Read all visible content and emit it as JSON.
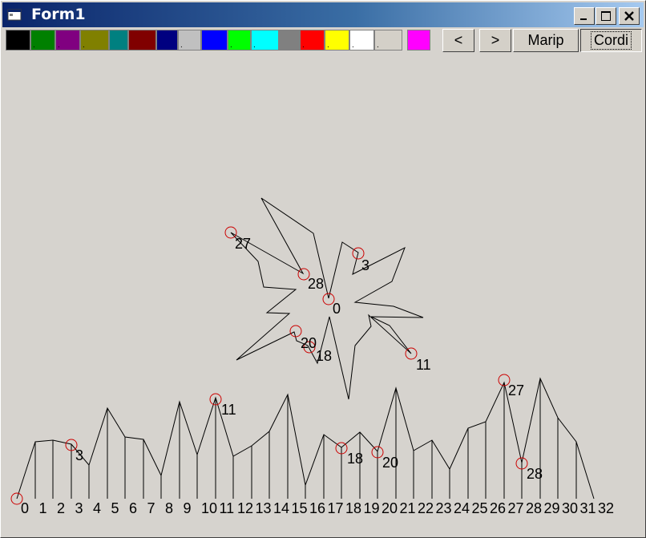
{
  "window": {
    "title": "Form1"
  },
  "palette": [
    {
      "color": "#000000",
      "mark": ""
    },
    {
      "color": "#008000",
      "mark": "."
    },
    {
      "color": "#800080",
      "mark": "."
    },
    {
      "color": "#808000",
      "mark": "."
    },
    {
      "color": "#008080",
      "mark": ""
    },
    {
      "color": "#800000",
      "mark": ""
    },
    {
      "color": "#000080",
      "mark": ""
    },
    {
      "color": "#c0c0c0",
      "mark": "."
    },
    {
      "color": "#0000ff",
      "mark": ""
    },
    {
      "color": "#00ff00",
      "mark": "."
    },
    {
      "color": "#00ffff",
      "mark": "."
    },
    {
      "color": "#808080",
      "mark": ""
    },
    {
      "color": "#ff0000",
      "mark": "."
    },
    {
      "color": "#ffff00",
      "mark": "."
    },
    {
      "color": "#ffffff",
      "mark": "."
    },
    {
      "color": "#d4d0c8",
      "mark": "."
    },
    {
      "color": "#ff00ff",
      "mark": ""
    }
  ],
  "toolbar": {
    "prev_label": "<",
    "next_label": ">",
    "manip_label": "Marip",
    "cordi_label": "Cordi"
  },
  "plot": {
    "line_color": "#000000",
    "marker_color": "#cc0000",
    "radar_labels": [
      {
        "id": "27",
        "text": "27"
      },
      {
        "id": "28",
        "text": "28"
      },
      {
        "id": "3",
        "text": "3"
      },
      {
        "id": "0",
        "text": "0"
      },
      {
        "id": "20",
        "text": "20"
      },
      {
        "id": "18",
        "text": "18"
      },
      {
        "id": "11",
        "text": "11"
      }
    ],
    "series_labels": [
      {
        "id": "3",
        "text": "3"
      },
      {
        "id": "11",
        "text": "11"
      },
      {
        "id": "18",
        "text": "18"
      },
      {
        "id": "20",
        "text": "20"
      },
      {
        "id": "27",
        "text": "27"
      },
      {
        "id": "28",
        "text": "28"
      }
    ],
    "axis_labels": [
      "0",
      "1",
      "2",
      "3",
      "4",
      "5",
      "6",
      "7",
      "8",
      "9",
      "10",
      "11",
      "12",
      "13",
      "14",
      "15",
      "16",
      "17",
      "18",
      "19",
      "20",
      "21",
      "22",
      "23",
      "24",
      "25",
      "26",
      "27",
      "28",
      "29",
      "30",
      "31",
      "32"
    ]
  }
}
